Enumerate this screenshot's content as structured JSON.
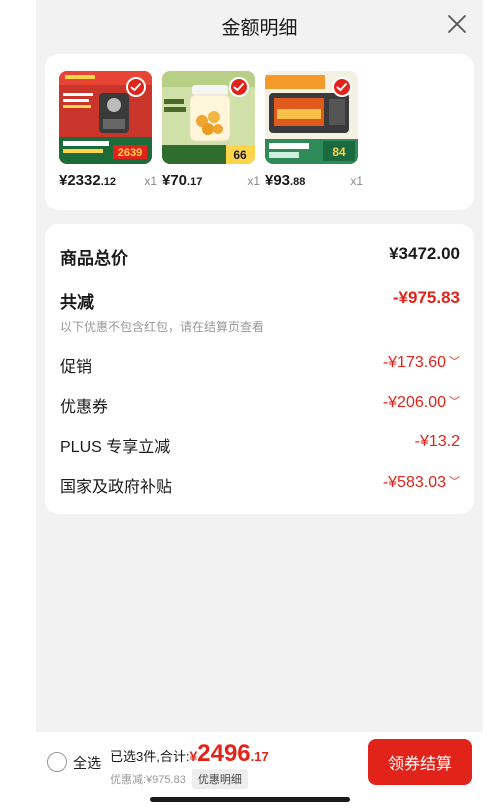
{
  "header": {
    "title": "金额明细"
  },
  "products": [
    {
      "price_int": "¥2332",
      "price_dec": ".12",
      "qty": "x1",
      "thumb_label": "2639"
    },
    {
      "price_int": "¥70",
      "price_dec": ".17",
      "qty": "x1",
      "thumb_label": "66"
    },
    {
      "price_int": "¥93",
      "price_dec": ".88",
      "qty": "x1",
      "thumb_label": "84"
    }
  ],
  "summary": {
    "total_label": "商品总价",
    "total_value": "¥3472.00",
    "reduce_label": "共减",
    "reduce_value": "-¥975.83",
    "note": "以下优惠不包含红包，请在结算页查看",
    "items": [
      {
        "label": "促销",
        "value": "-¥173.60",
        "chevron": "﹀"
      },
      {
        "label": "优惠券",
        "value": "-¥206.00",
        "chevron": "﹀"
      },
      {
        "label": "PLUS 专享立减",
        "value": "-¥13.2",
        "chevron": ""
      },
      {
        "label": "国家及政府补贴",
        "value": "-¥583.03",
        "chevron": "﹀"
      }
    ]
  },
  "footer": {
    "select_all": "全选",
    "selected_text": "已选3件,合计:",
    "currency": "¥",
    "total_int": "2496",
    "total_dec": ".17",
    "discount_text": "优惠减:¥975.83",
    "detail_button": "优惠明细",
    "checkout_button": "领券结算"
  },
  "colors": {
    "accent": "#e2231a",
    "background": "#f2f2f2"
  }
}
